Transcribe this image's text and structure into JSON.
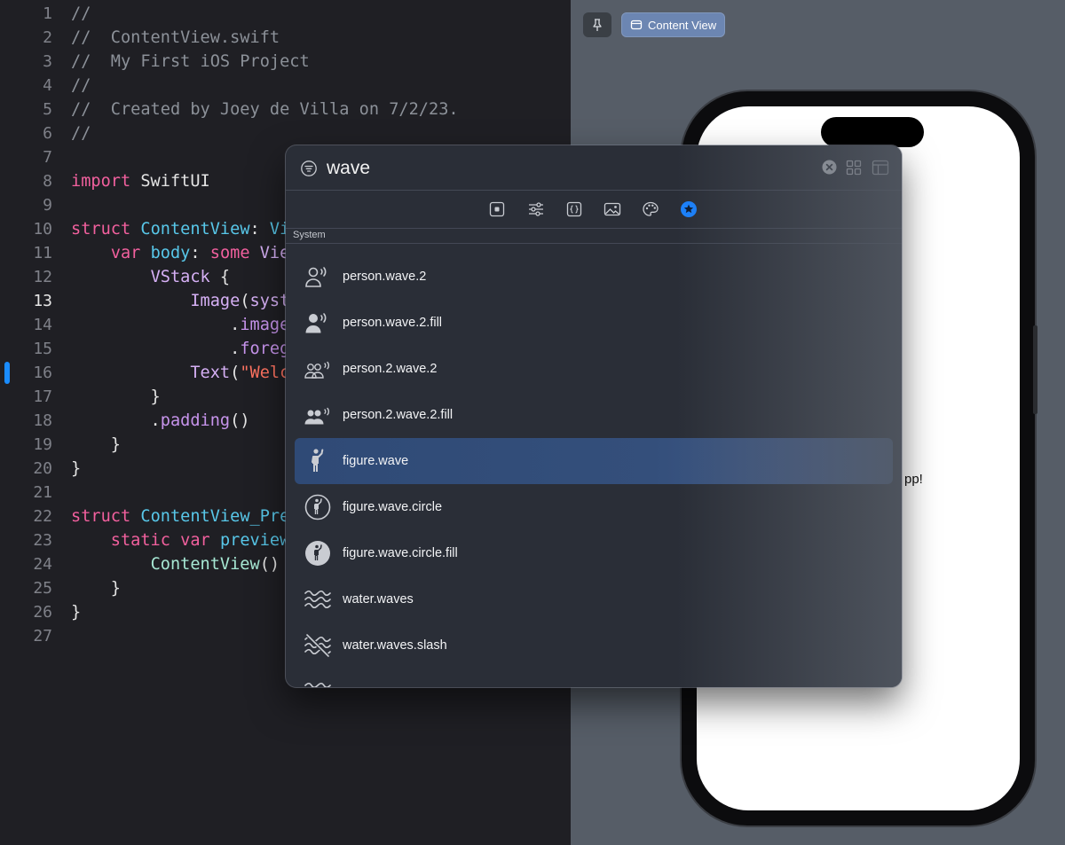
{
  "editor": {
    "current_line": 13,
    "lines": [
      {
        "n": "1",
        "t": [
          [
            "cm",
            "//"
          ]
        ]
      },
      {
        "n": "2",
        "t": [
          [
            "cm",
            "//  ContentView.swift"
          ]
        ]
      },
      {
        "n": "3",
        "t": [
          [
            "cm",
            "//  My First iOS Project"
          ]
        ]
      },
      {
        "n": "4",
        "t": [
          [
            "cm",
            "//"
          ]
        ]
      },
      {
        "n": "5",
        "t": [
          [
            "cm",
            "//  Created by Joey de Villa on 7/2/23."
          ]
        ]
      },
      {
        "n": "6",
        "t": [
          [
            "cm",
            "//"
          ]
        ]
      },
      {
        "n": "7",
        "t": []
      },
      {
        "n": "8",
        "t": [
          [
            "kw",
            "import"
          ],
          [
            "plain",
            " SwiftUI"
          ]
        ]
      },
      {
        "n": "9",
        "t": []
      },
      {
        "n": "10",
        "t": [
          [
            "kw",
            "struct"
          ],
          [
            "plain",
            " "
          ],
          [
            "type",
            "ContentView"
          ],
          [
            "plain",
            ": "
          ],
          [
            "type",
            "Vi"
          ]
        ]
      },
      {
        "n": "11",
        "t": [
          [
            "plain",
            "    "
          ],
          [
            "kw",
            "var"
          ],
          [
            "plain",
            " "
          ],
          [
            "type",
            "body"
          ],
          [
            "plain",
            ": "
          ],
          [
            "kw",
            "some"
          ],
          [
            "plain",
            " "
          ],
          [
            "ty2",
            "Vie"
          ]
        ]
      },
      {
        "n": "12",
        "t": [
          [
            "plain",
            "        "
          ],
          [
            "ty2",
            "VStack"
          ],
          [
            "plain",
            " {"
          ]
        ]
      },
      {
        "n": "13",
        "t": [
          [
            "plain",
            "            "
          ],
          [
            "ty2",
            "Image"
          ],
          [
            "plain",
            "("
          ],
          [
            "ty2",
            "syst"
          ]
        ]
      },
      {
        "n": "14",
        "t": [
          [
            "plain",
            "                ."
          ],
          [
            "call",
            "image"
          ]
        ]
      },
      {
        "n": "15",
        "t": [
          [
            "plain",
            "                ."
          ],
          [
            "call",
            "foreg"
          ]
        ]
      },
      {
        "n": "16",
        "t": [
          [
            "plain",
            "            "
          ],
          [
            "ty2",
            "Text"
          ],
          [
            "plain",
            "("
          ],
          [
            "str",
            "\"Welc"
          ]
        ]
      },
      {
        "n": "17",
        "t": [
          [
            "plain",
            "        }"
          ]
        ]
      },
      {
        "n": "18",
        "t": [
          [
            "plain",
            "        ."
          ],
          [
            "call",
            "padding"
          ],
          [
            "plain",
            "()"
          ]
        ]
      },
      {
        "n": "19",
        "t": [
          [
            "plain",
            "    }"
          ]
        ]
      },
      {
        "n": "20",
        "t": [
          [
            "plain",
            "}"
          ]
        ]
      },
      {
        "n": "21",
        "t": []
      },
      {
        "n": "22",
        "t": [
          [
            "kw",
            "struct"
          ],
          [
            "plain",
            " "
          ],
          [
            "type",
            "ContentView_Pre"
          ]
        ]
      },
      {
        "n": "23",
        "t": [
          [
            "plain",
            "    "
          ],
          [
            "kw",
            "static"
          ],
          [
            "plain",
            " "
          ],
          [
            "kw",
            "var"
          ],
          [
            "plain",
            " "
          ],
          [
            "type",
            "preview"
          ]
        ]
      },
      {
        "n": "24",
        "t": [
          [
            "plain",
            "        "
          ],
          [
            "fn",
            "ContentView"
          ],
          [
            "plain",
            "()"
          ]
        ]
      },
      {
        "n": "25",
        "t": [
          [
            "plain",
            "    }"
          ]
        ]
      },
      {
        "n": "26",
        "t": [
          [
            "plain",
            "}"
          ]
        ]
      },
      {
        "n": "27",
        "t": []
      }
    ]
  },
  "canvas": {
    "pin_icon": "pin-icon",
    "content_view_label": "Content View",
    "preview_text_visible": "pp!"
  },
  "library": {
    "search": {
      "value": "wave"
    },
    "icons": {
      "filter": "filter-icon",
      "clear": "clear-search-icon",
      "grid": "grid-view-icon",
      "detail": "detail-view-icon"
    },
    "tabs": [
      {
        "name": "views-tab",
        "icon": "square-dot-icon",
        "selected": false
      },
      {
        "name": "modifiers-tab",
        "icon": "sliders-icon",
        "selected": false
      },
      {
        "name": "snippets-tab",
        "icon": "braces-icon",
        "selected": false
      },
      {
        "name": "media-tab",
        "icon": "photo-icon",
        "selected": false
      },
      {
        "name": "colors-tab",
        "icon": "palette-icon",
        "selected": false
      },
      {
        "name": "symbols-tab",
        "icon": "star-circle-icon",
        "selected": true
      }
    ],
    "section_label": "System",
    "accent_color": "#1a82ff",
    "selected_index": 4,
    "items": [
      {
        "label": "person.wave.2",
        "icon": "person-wave-icon"
      },
      {
        "label": "person.wave.2.fill",
        "icon": "person-wave-fill-icon"
      },
      {
        "label": "person.2.wave.2",
        "icon": "person-2-wave-icon"
      },
      {
        "label": "person.2.wave.2.fill",
        "icon": "person-2-wave-fill-icon"
      },
      {
        "label": "figure.wave",
        "icon": "figure-wave-icon"
      },
      {
        "label": "figure.wave.circle",
        "icon": "figure-wave-circle-icon"
      },
      {
        "label": "figure.wave.circle.fill",
        "icon": "figure-wave-circle-fill-icon"
      },
      {
        "label": "water.waves",
        "icon": "water-waves-icon"
      },
      {
        "label": "water.waves.slash",
        "icon": "water-waves-slash-icon"
      }
    ]
  }
}
